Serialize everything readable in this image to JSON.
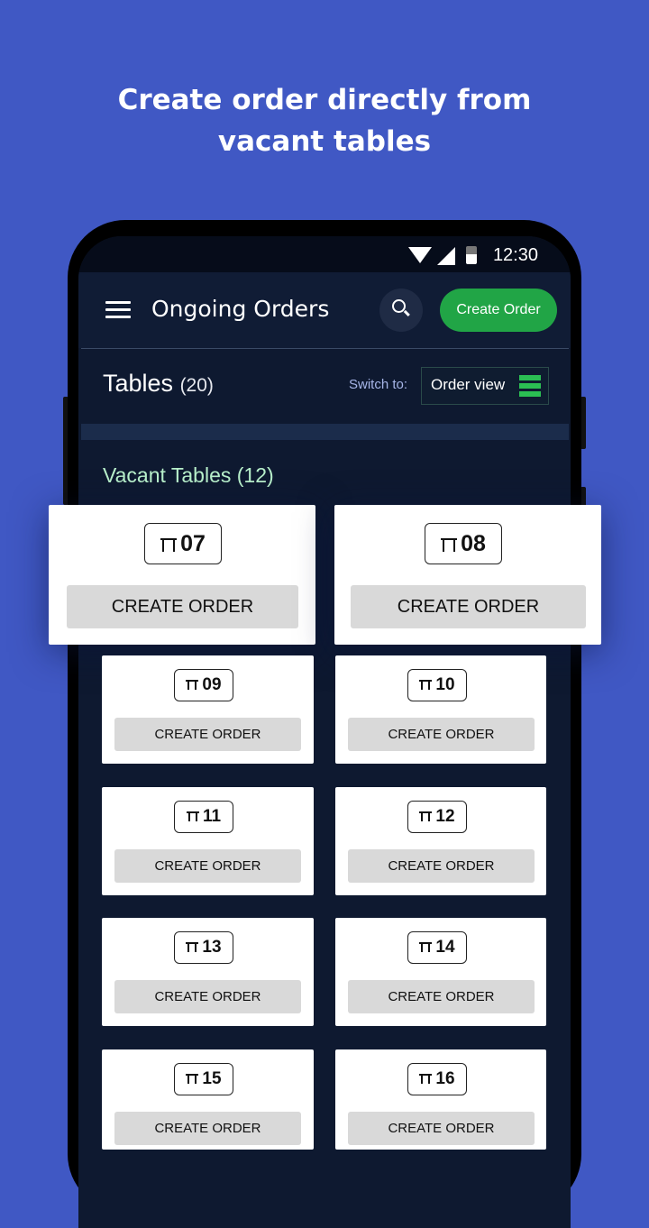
{
  "headline": {
    "line1": "Create order directly from",
    "line2": "vacant tables"
  },
  "status_bar": {
    "time": "12:30",
    "icons": [
      "wifi-icon",
      "signal-icon",
      "battery-icon"
    ]
  },
  "app_bar": {
    "title": "Ongoing Orders",
    "menu_icon": "menu-icon",
    "search_icon": "search-icon",
    "create_order_label": "Create Order"
  },
  "tables_header": {
    "title": "Tables",
    "count": "(20)",
    "switch_label": "Switch to:",
    "switch_option": "Order view",
    "switch_icon": "list-icon"
  },
  "section": {
    "title": "Vacant Tables (12)"
  },
  "tables": [
    {
      "number": "07",
      "button": "CREATE ORDER"
    },
    {
      "number": "08",
      "button": "CREATE ORDER"
    },
    {
      "number": "09",
      "button": "CREATE ORDER"
    },
    {
      "number": "10",
      "button": "CREATE ORDER"
    },
    {
      "number": "11",
      "button": "CREATE ORDER"
    },
    {
      "number": "12",
      "button": "CREATE ORDER"
    },
    {
      "number": "13",
      "button": "CREATE ORDER"
    },
    {
      "number": "14",
      "button": "CREATE ORDER"
    },
    {
      "number": "15",
      "button": "CREATE ORDER"
    },
    {
      "number": "16",
      "button": "CREATE ORDER"
    }
  ],
  "colors": {
    "background": "#4058c4",
    "screen": "#0e1930",
    "accent_green": "#21a546",
    "section_title": "#b8f0cb",
    "card_button": "#d9d9d9"
  }
}
